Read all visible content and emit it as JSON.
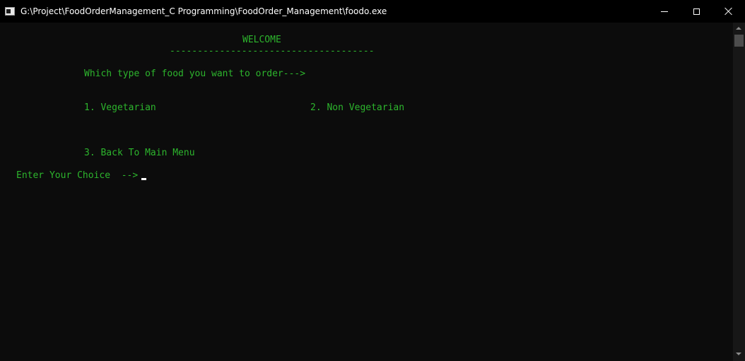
{
  "window": {
    "title": "G:\\Project\\FoodOrderManagement_C Programming\\FoodOrder_Management\\foodo.exe",
    "controls": {
      "minimize": "minimize-icon",
      "maximize": "maximize-icon",
      "close": "close-icon"
    }
  },
  "console": {
    "text_color": "#2db52d",
    "background": "#0c0c0c",
    "welcome": "WELCOME",
    "divider": "-------------------------------------",
    "prompt_food_type": "Which type of food you want to order--->",
    "option_1": "1. Vegetarian",
    "option_2": "2. Non Vegetarian",
    "option_3": "3. Back To Main Menu",
    "input_prompt": "Enter Your Choice  -->"
  }
}
